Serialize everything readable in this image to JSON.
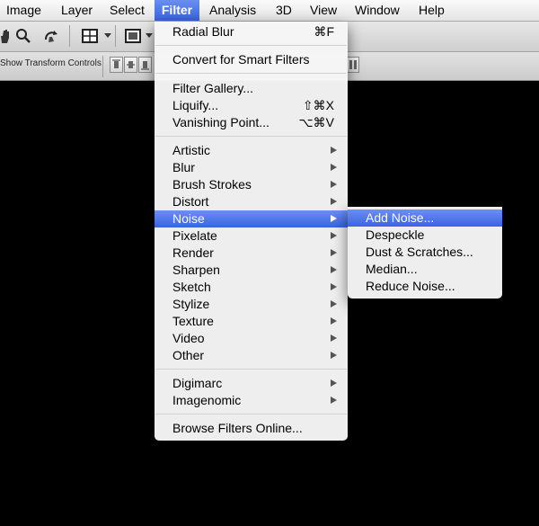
{
  "menubar": {
    "items": [
      "Image",
      "Layer",
      "Select",
      "Filter",
      "Analysis",
      "3D",
      "View",
      "Window",
      "Help"
    ],
    "active": "Filter"
  },
  "optionsbar": {
    "show_transform_label": "Show Transform Controls",
    "tool_icons": [
      "hand-icon",
      "zoom-icon",
      "rotate-view-icon",
      "arrange-documents-icon",
      "screen-mode-icon"
    ]
  },
  "filter_menu": {
    "last_filter": {
      "label": "Radial Blur",
      "shortcut": "⌘F"
    },
    "convert_smart": {
      "label": "Convert for Smart Filters"
    },
    "filter_gallery": {
      "label": "Filter Gallery..."
    },
    "liquify": {
      "label": "Liquify...",
      "shortcut": "⇧⌘X"
    },
    "vanishing_point": {
      "label": "Vanishing Point...",
      "shortcut": "⌥⌘V"
    },
    "categories": [
      "Artistic",
      "Blur",
      "Brush Strokes",
      "Distort",
      "Noise",
      "Pixelate",
      "Render",
      "Sharpen",
      "Sketch",
      "Stylize",
      "Texture",
      "Video",
      "Other"
    ],
    "highlighted_category": "Noise",
    "plugins": [
      "Digimarc",
      "Imagenomic"
    ],
    "browse_online": {
      "label": "Browse Filters Online..."
    }
  },
  "noise_submenu": {
    "items": [
      "Add Noise...",
      "Despeckle",
      "Dust & Scratches...",
      "Median...",
      "Reduce Noise..."
    ],
    "highlighted": "Add Noise..."
  },
  "colors": {
    "highlight": "#3b63e2",
    "menu_background": "#f6f6f6",
    "canvas": "#000000"
  }
}
